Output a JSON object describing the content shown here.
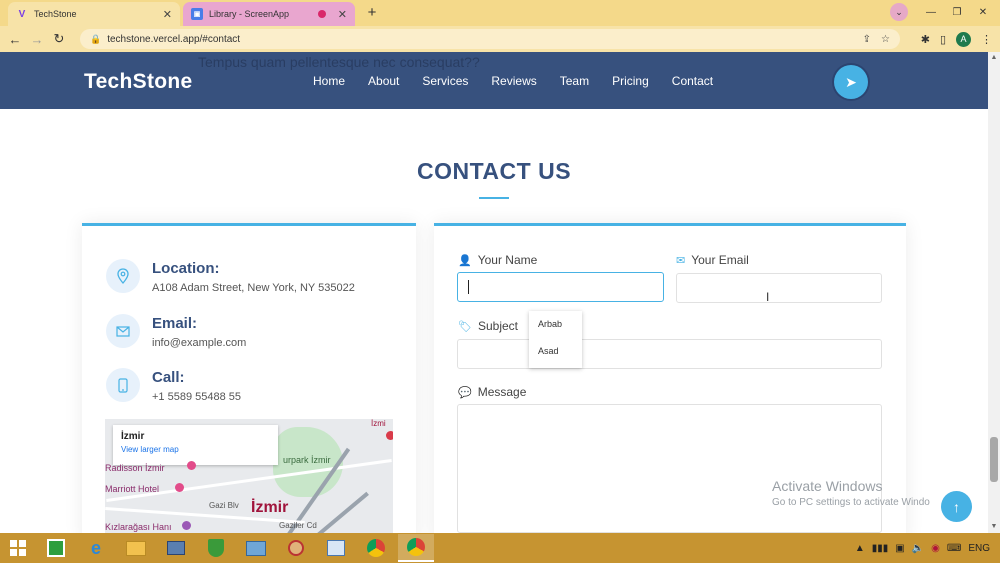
{
  "browser": {
    "tabs": [
      {
        "title": "TechStone",
        "icon": "v-logo-icon",
        "active": true
      },
      {
        "title": "Library - ScreenApp",
        "icon": "screenapp-icon",
        "active": false
      }
    ],
    "url": "techstone.vercel.app/#contact",
    "profile_initial": "A"
  },
  "header": {
    "ghost_text": "Tempus quam pellentesque nec consequat??",
    "logo": "TechStone",
    "nav": [
      "Home",
      "About",
      "Services",
      "Reviews",
      "Team",
      "Pricing",
      "Contact"
    ]
  },
  "section": {
    "title": "CONTACT US"
  },
  "info": {
    "location_label": "Location:",
    "location_value": "A108 Adam Street, New York, NY 535022",
    "email_label": "Email:",
    "email_value": "info@example.com",
    "call_label": "Call:",
    "call_value": "+1 5589 55488 55",
    "map": {
      "place": "İzmir",
      "link": "View larger map",
      "city": "İzmir",
      "labels": {
        "radisson": "Radisson İzmir",
        "marriott": "Marriott Hotel",
        "kizlaragasi": "Kızlarağası Hanı",
        "gazi": "Gazi Blv",
        "gaziler": "Gaziler Cd",
        "kulturpark": "urpark İzmir",
        "izmir_top": "İzmi"
      }
    }
  },
  "form": {
    "name_label": "Your Name",
    "email_label": "Your Email",
    "subject_label": "Subject",
    "message_label": "Message",
    "name_value": "",
    "email_value": "",
    "subject_value": "",
    "message_value": "",
    "autocomplete": [
      "Arbab",
      "Asad"
    ]
  },
  "watermark": {
    "line1": "Activate Windows",
    "line2": "Go to PC settings to activate Windo"
  },
  "taskbar": {
    "language": "ENG"
  },
  "colors": {
    "primary": "#37517e",
    "accent": "#47b2e4",
    "tab_bar": "#f4d98a",
    "taskbar": "#c69431"
  }
}
